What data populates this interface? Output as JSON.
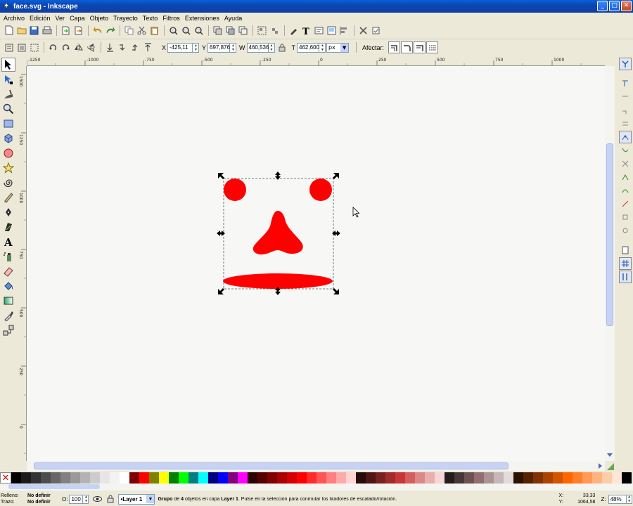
{
  "window": {
    "title": "face.svg - Inkscape"
  },
  "menu": [
    "Archivo",
    "Edición",
    "Ver",
    "Capa",
    "Objeto",
    "Trayecto",
    "Texto",
    "Filtros",
    "Extensiones",
    "Ayuda"
  ],
  "controls": {
    "x_label": "X",
    "x_value": "-425,11",
    "y_label": "Y",
    "y_value": "697,876",
    "w_label": "W",
    "w_value": "460,536",
    "h_label": "T",
    "h_value": "462,600",
    "unit": "px",
    "affect_label": "Afectar:"
  },
  "hruler": {
    "labels": [
      "-1250",
      "-1000",
      "-750",
      "-500",
      "-250",
      "0",
      "250",
      "500",
      "750",
      "1000"
    ]
  },
  "vruler": {
    "labels": [
      "1500",
      "1250",
      "1000",
      "750",
      "500",
      "250",
      "0"
    ]
  },
  "drawing": {
    "fill_color": "#ff0000"
  },
  "palette": {
    "colors": [
      "#000000",
      "#1a1a1a",
      "#333333",
      "#4d4d4d",
      "#666666",
      "#808080",
      "#999999",
      "#b3b3b3",
      "#cccccc",
      "#e6e6e6",
      "#f2f2f2",
      "#ffffff",
      "#800000",
      "#ff0000",
      "#808000",
      "#ffff00",
      "#008000",
      "#00ff00",
      "#008080",
      "#00ffff",
      "#000080",
      "#0000ff",
      "#800080",
      "#ff00ff",
      "#2b0000",
      "#550000",
      "#800000",
      "#aa0000",
      "#d40000",
      "#ff0000",
      "#ff2a2a",
      "#ff5555",
      "#ff8080",
      "#ffaaaa",
      "#ffd5d5",
      "#280b0b",
      "#501616",
      "#782121",
      "#a02c2c",
      "#c83737",
      "#d35f5f",
      "#de8787",
      "#e9afaf",
      "#f4d7d7",
      "#241c1c",
      "#483737",
      "#6c5353",
      "#916f6f",
      "#ac9393",
      "#c8b7b7",
      "#e3dbdb",
      "#2b1100",
      "#552200",
      "#803300",
      "#aa4400",
      "#d45500",
      "#ff6600",
      "#ff7f2a",
      "#ff9955",
      "#ffb380",
      "#ffccaa",
      "#ffe6d5",
      "#000000"
    ]
  },
  "status": {
    "fill_label": "Relleno:",
    "fill_value": "No definir",
    "stroke_label": "Trazo:",
    "stroke_value": "No definir",
    "opacity_label": "O:",
    "opacity_value": "100",
    "layer": "•Layer 1",
    "message_bold_1": "Grupo",
    "message_part_1": " de ",
    "message_bold_2": "4",
    "message_part_2": " objetos en capa ",
    "message_bold_3": "Layer 1",
    "message_part_3": ". Pulse en la selección para conmutar los tiradores de escalado/rotación.",
    "cursor_x_label": "X:",
    "cursor_x": "33,33",
    "cursor_y_label": "Y:",
    "cursor_y": "1064,58",
    "zoom_label": "Z:",
    "zoom": "48%"
  }
}
